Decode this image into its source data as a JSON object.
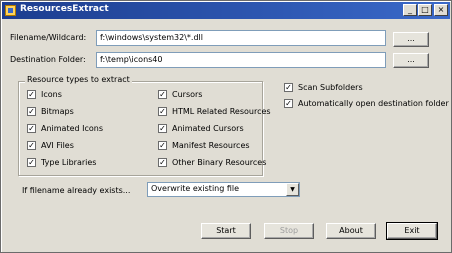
{
  "window": {
    "title": "ResourcesExtract",
    "minimize_glyph": "_",
    "maximize_glyph": "□",
    "close_glyph": "×"
  },
  "filename": {
    "label": "Filename/Wildcard:",
    "value": "f:\\windows\\system32\\*.dll",
    "browse_label": "..."
  },
  "destination": {
    "label": "Destination Folder:",
    "value": "f:\\temp\\icons40",
    "browse_label": "..."
  },
  "resource_types": {
    "title": "Resource types to extract",
    "items": [
      {
        "label": "Icons",
        "checked": true
      },
      {
        "label": "Bitmaps",
        "checked": true
      },
      {
        "label": "Animated Icons",
        "checked": true
      },
      {
        "label": "AVI Files",
        "checked": true
      },
      {
        "label": "Type Libraries",
        "checked": true
      },
      {
        "label": "Cursors",
        "checked": true
      },
      {
        "label": "HTML Related Resources",
        "checked": true
      },
      {
        "label": "Animated Cursors",
        "checked": true
      },
      {
        "label": "Manifest Resources",
        "checked": true
      },
      {
        "label": "Other Binary Resources",
        "checked": true
      }
    ]
  },
  "options": {
    "scan_subfolders": {
      "label": "Scan Subfolders",
      "checked": true
    },
    "auto_open": {
      "label": "Automatically open destination folder",
      "checked": true
    }
  },
  "exists_option": {
    "label": "If filename already exists...",
    "value": "Overwrite existing file"
  },
  "buttons": {
    "start": "Start",
    "stop": "Stop",
    "about": "About",
    "exit": "Exit"
  },
  "check_glyph": "✓"
}
